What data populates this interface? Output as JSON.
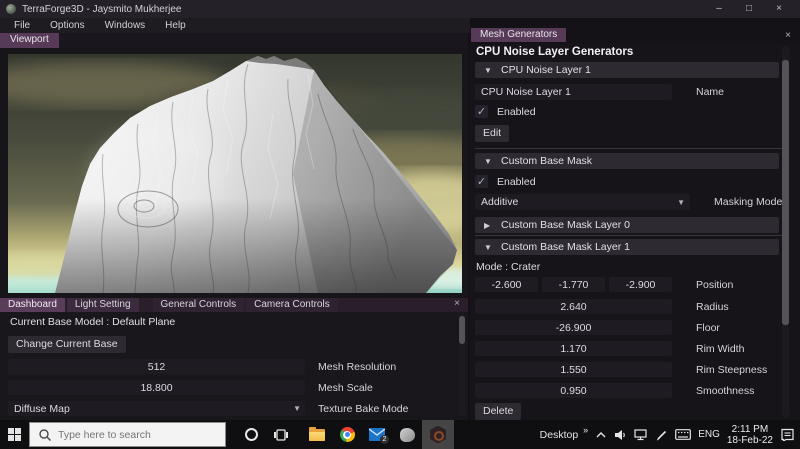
{
  "titlebar": {
    "title": "TerraForge3D - Jaysmito Mukherjee"
  },
  "menu": {
    "items": [
      "File",
      "Options",
      "Windows",
      "Help"
    ]
  },
  "viewport": {
    "tab_label": "Viewport"
  },
  "right_panel": {
    "tab_label": "Mesh Generators",
    "title": "CPU Noise Layer Generators",
    "noise_layer": {
      "header": "CPU Noise Layer 1",
      "name_value": "CPU Noise Layer 1",
      "name_label": "Name",
      "enabled_label": "Enabled",
      "edit_label": "Edit"
    },
    "mask": {
      "header": "Custom Base Mask",
      "enabled_label": "Enabled",
      "mode_value": "Additive",
      "mode_label": "Masking Mode",
      "layer0_header": "Custom Base Mask Layer 0",
      "layer1_header": "Custom Base Mask Layer 1"
    },
    "crater": {
      "mode_text": "Mode : Crater",
      "position_label": "Position",
      "position_values": [
        "-2.600",
        "-1.770",
        "-2.900"
      ],
      "fields": [
        {
          "value": "2.640",
          "label": "Radius"
        },
        {
          "value": "-26.900",
          "label": "Floor"
        },
        {
          "value": "1.170",
          "label": "Rim Width"
        },
        {
          "value": "1.550",
          "label": "Rim Steepness"
        },
        {
          "value": "0.950",
          "label": "Smoothness"
        }
      ],
      "delete_label": "Delete"
    }
  },
  "bottom_panel": {
    "tabs": [
      "Dashboard",
      "Light Setting",
      "General Controls",
      "Camera Controls"
    ],
    "current_base": "Current Base Model : Default Plane",
    "change_base_label": "Change Current Base",
    "mesh_resolution": {
      "value": "512",
      "label": "Mesh Resolution"
    },
    "mesh_scale": {
      "value": "18.800",
      "label": "Mesh Scale"
    },
    "texture_bake": {
      "value": "Diffuse Map",
      "label": "Texture Bake Mode"
    }
  },
  "taskbar": {
    "search_placeholder": "Type here to search",
    "desktop_label": "Desktop",
    "overflow_chevron": "»",
    "language": "ENG",
    "time": "2:11 PM",
    "date": "18-Feb-22",
    "mail_badge": "2"
  },
  "icons": {
    "collapse_open": "▼",
    "collapse_closed": "▶",
    "combo_arrow": "▼",
    "check": "✓",
    "close": "×",
    "minimize": "–",
    "maximize": "□"
  },
  "colors": {
    "accent_purple": "#5a3c5b",
    "taskbar_active_bg": "#454545"
  }
}
